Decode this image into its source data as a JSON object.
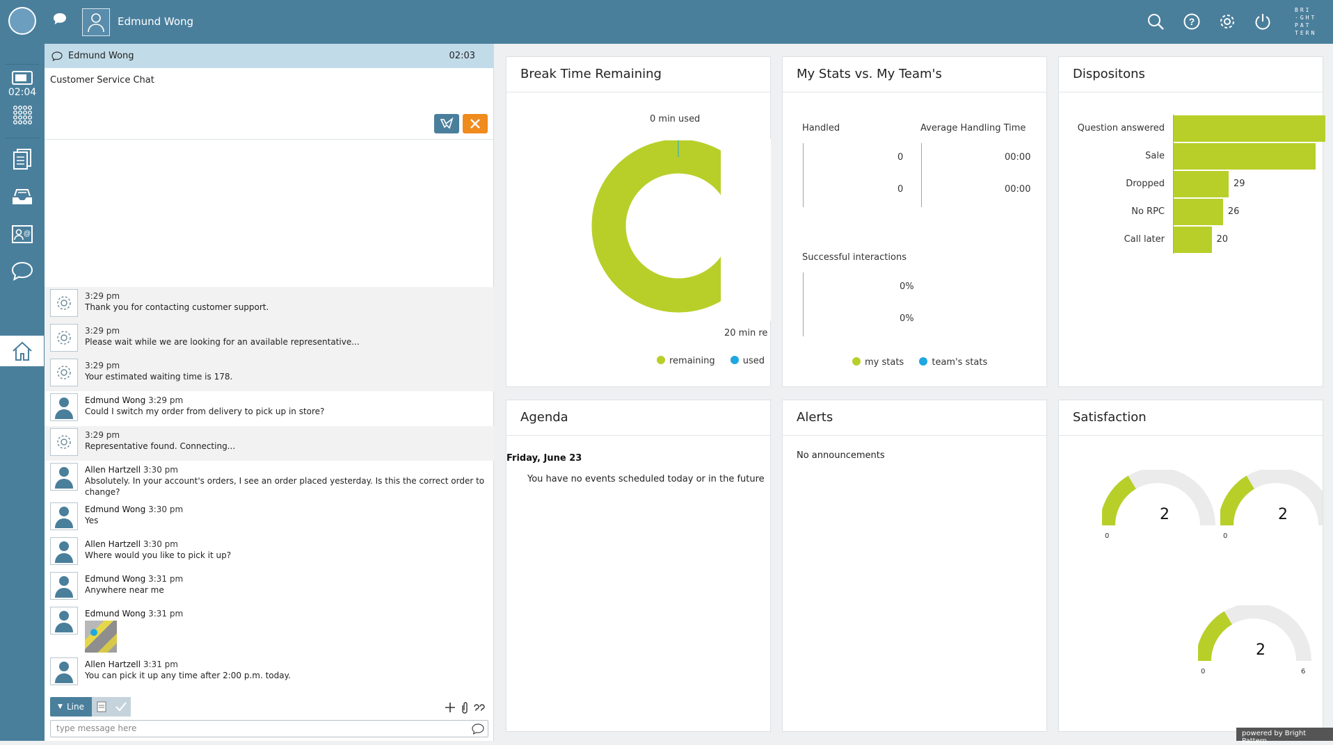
{
  "top": {
    "agent_name": "Edmund Wong",
    "timer": "02:04",
    "logo_lines": [
      "BRI",
      "·GHT",
      "PAT",
      "TERN"
    ]
  },
  "chat": {
    "header_name": "Edmund Wong",
    "header_time": "02:03",
    "subject": "Customer Service Chat",
    "messages": [
      {
        "kind": "system",
        "author": "",
        "time": "3:29 pm",
        "text": "Thank you for contacting customer support."
      },
      {
        "kind": "system",
        "author": "",
        "time": "3:29 pm",
        "text": "Please wait while we are looking for an available representative..."
      },
      {
        "kind": "system",
        "author": "",
        "time": "3:29 pm",
        "text": "Your estimated waiting time is 178."
      },
      {
        "kind": "user",
        "author": "Edmund Wong",
        "time": "3:29 pm",
        "text": "Could I switch my order from delivery to pick up in store?"
      },
      {
        "kind": "system",
        "author": "",
        "time": "3:29 pm",
        "text": "Representative found. Connecting..."
      },
      {
        "kind": "user",
        "author": "Allen Hartzell",
        "time": "3:30 pm",
        "text": "Absolutely. In your account's orders, I see an order placed yesterday. Is this the correct order to change?"
      },
      {
        "kind": "user",
        "author": "Edmund Wong",
        "time": "3:30 pm",
        "text": "Yes"
      },
      {
        "kind": "user",
        "author": "Allen Hartzell",
        "time": "3:30 pm",
        "text": "Where would you like to pick it up?"
      },
      {
        "kind": "user",
        "author": "Edmund Wong",
        "time": "3:31 pm",
        "text": "Anywhere near me"
      },
      {
        "kind": "image",
        "author": "Edmund Wong",
        "time": "3:31 pm",
        "text": ""
      },
      {
        "kind": "user",
        "author": "Allen Hartzell",
        "time": "3:31 pm",
        "text": "You can pick it up any time after 2:00 p.m. today."
      }
    ],
    "line_label": "Line",
    "input_placeholder": "type message here"
  },
  "break_card": {
    "title": "Break Time Remaining",
    "used_label": "0 min used",
    "remaining_label": "20 min re",
    "legend_remaining": "remaining",
    "legend_used": "used",
    "remaining_fraction": 1.0
  },
  "stats_card": {
    "title": "My Stats vs. My Team's",
    "handled_label": "Handled",
    "aht_label": "Average Handling Time",
    "handled_values": [
      "0",
      "0"
    ],
    "aht_values": [
      "00:00",
      "00:00"
    ],
    "success_label": "Successful interactions",
    "success_values": [
      "0%",
      "0%"
    ],
    "legend_my": "my stats",
    "legend_team": "team's stats"
  },
  "dispositions_card": {
    "title": "Dispositons",
    "chart_data": {
      "type": "bar",
      "orientation": "horizontal",
      "categories": [
        "Question answered",
        "Sale",
        "Dropped",
        "No RPC",
        "Call later"
      ],
      "values": [
        80,
        75,
        29,
        26,
        20
      ],
      "value_labels": [
        "",
        "",
        "29",
        "26",
        "20"
      ]
    }
  },
  "agenda_card": {
    "title": "Agenda",
    "date": "Friday, June 23",
    "message": "You have no events scheduled today or in the future"
  },
  "alerts_card": {
    "title": "Alerts",
    "message": "No announcements"
  },
  "satisfaction_card": {
    "title": "Satisfaction",
    "gauges": [
      {
        "value": "2",
        "min": "0",
        "max": "",
        "fraction": 0.33
      },
      {
        "value": "2",
        "min": "0",
        "max": "",
        "fraction": 0.33
      },
      {
        "value": "2",
        "min": "0",
        "max": "6",
        "fraction": 0.33
      }
    ]
  },
  "footer": "powered by Bright Pattern",
  "colors": {
    "accent": "#4a7f9c",
    "green": "#b8cf29",
    "blue": "#1ea7e0",
    "orange": "#f08b1d"
  }
}
